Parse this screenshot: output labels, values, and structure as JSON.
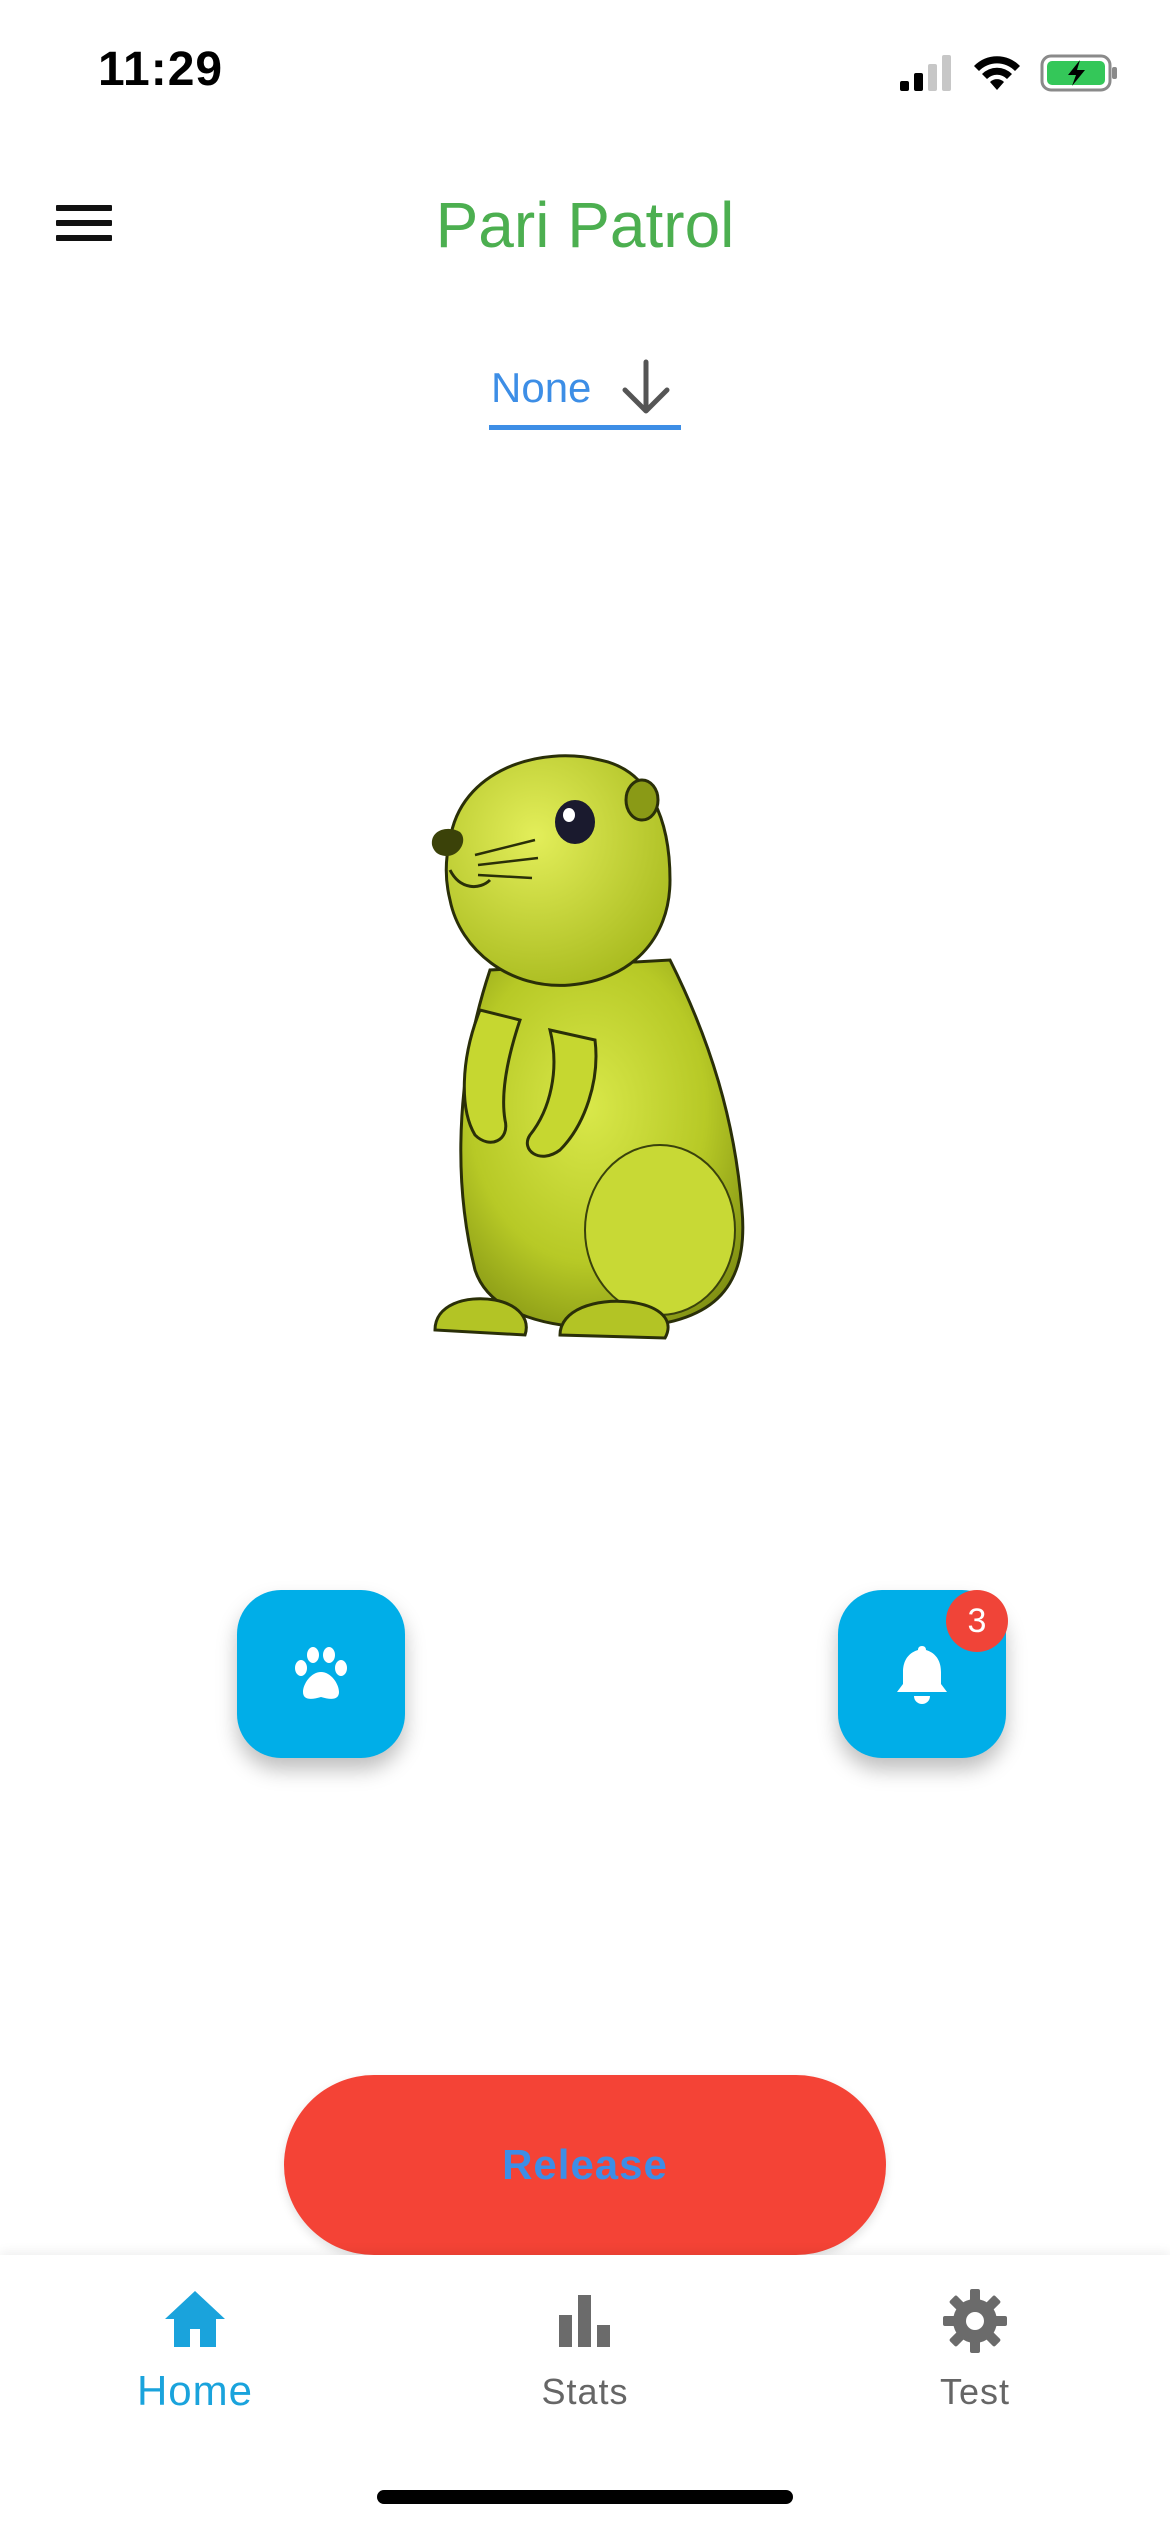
{
  "status_bar": {
    "time": "11:29"
  },
  "app_bar": {
    "title": "Pari Patrol",
    "menu_icon": "hamburger-menu-icon"
  },
  "dropdown": {
    "value": "None",
    "icon": "arrow-down-icon"
  },
  "mascot": {
    "icon": "groundhog-mascot"
  },
  "actions": {
    "paw_icon": "paw-icon",
    "bell_icon": "bell-icon",
    "notification_count": "3"
  },
  "release_button": {
    "label": "Release"
  },
  "bottom_nav": {
    "items": [
      {
        "label": "Home",
        "icon": "home-icon",
        "active": true
      },
      {
        "label": "Stats",
        "icon": "bar-chart-icon",
        "active": false
      },
      {
        "label": "Test",
        "icon": "gear-icon",
        "active": false
      }
    ]
  },
  "colors": {
    "title": "#4caf50",
    "accent_blue": "#00aee8",
    "dropdown_blue": "#3d8ee6",
    "release_red": "#f44336",
    "badge_red": "#f04438",
    "nav_active": "#1aa3dc"
  }
}
